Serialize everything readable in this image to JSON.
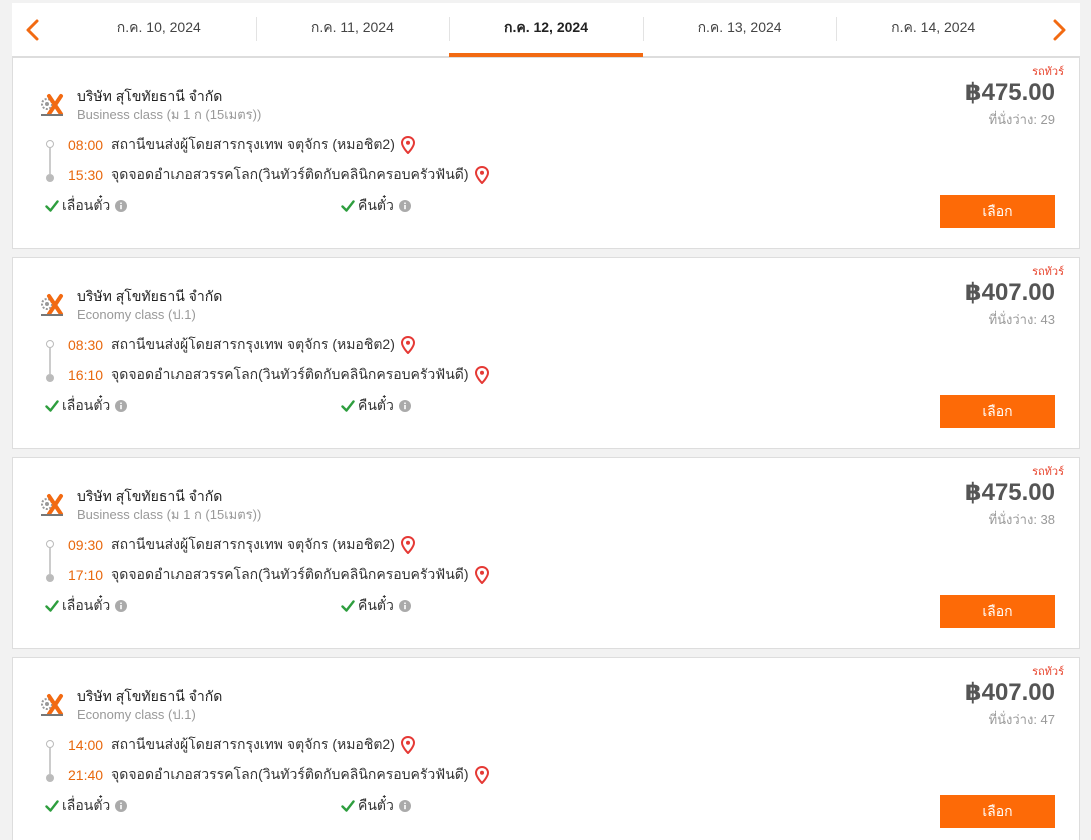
{
  "date_tabs": [
    {
      "label": "ก.ค. 10, 2024"
    },
    {
      "label": "ก.ค. 11, 2024"
    },
    {
      "label": "ก.ค. 12, 2024"
    },
    {
      "label": "ก.ค. 13, 2024"
    },
    {
      "label": "ก.ค. 14, 2024"
    }
  ],
  "active_tab_index": 2,
  "colors": {
    "accent": "#fd6a07",
    "time": "#e8670c",
    "pin": "#e53935",
    "check": "#2e9e3e"
  },
  "trips": [
    {
      "badge": "รถทัวร์",
      "operator": "บริษัท สุโขทัยธานี จำกัด",
      "class": "Business class (ม 1 ก (15เมตร))",
      "price": "฿475.00",
      "seats": "ที่นั่งว่าง: 29",
      "depart_time": "08:00",
      "depart_place": "สถานีขนส่งผู้โดยสารกรุงเทพ จตุจักร (หมอชิต2)",
      "arrive_time": "15:30",
      "arrive_place": "จุดจอดอำเภอสวรรคโลก(วินทัวร์ติดกับคลินิกครอบครัวฟันดี)",
      "feature_reschedule": "เลื่อนตั๋ว",
      "feature_refund": "คืนตั๋ว",
      "select_label": "เลือก"
    },
    {
      "badge": "รถทัวร์",
      "operator": "บริษัท สุโขทัยธานี จำกัด",
      "class": "Economy class (ป.1)",
      "price": "฿407.00",
      "seats": "ที่นั่งว่าง: 43",
      "depart_time": "08:30",
      "depart_place": "สถานีขนส่งผู้โดยสารกรุงเทพ จตุจักร (หมอชิต2)",
      "arrive_time": "16:10",
      "arrive_place": "จุดจอดอำเภอสวรรคโลก(วินทัวร์ติดกับคลินิกครอบครัวฟันดี)",
      "feature_reschedule": "เลื่อนตั๋ว",
      "feature_refund": "คืนตั๋ว",
      "select_label": "เลือก"
    },
    {
      "badge": "รถทัวร์",
      "operator": "บริษัท สุโขทัยธานี จำกัด",
      "class": "Business class (ม 1 ก (15เมตร))",
      "price": "฿475.00",
      "seats": "ที่นั่งว่าง: 38",
      "depart_time": "09:30",
      "depart_place": "สถานีขนส่งผู้โดยสารกรุงเทพ จตุจักร (หมอชิต2)",
      "arrive_time": "17:10",
      "arrive_place": "จุดจอดอำเภอสวรรคโลก(วินทัวร์ติดกับคลินิกครอบครัวฟันดี)",
      "feature_reschedule": "เลื่อนตั๋ว",
      "feature_refund": "คืนตั๋ว",
      "select_label": "เลือก"
    },
    {
      "badge": "รถทัวร์",
      "operator": "บริษัท สุโขทัยธานี จำกัด",
      "class": "Economy class (ป.1)",
      "price": "฿407.00",
      "seats": "ที่นั่งว่าง: 47",
      "depart_time": "14:00",
      "depart_place": "สถานีขนส่งผู้โดยสารกรุงเทพ จตุจักร (หมอชิต2)",
      "arrive_time": "21:40",
      "arrive_place": "จุดจอดอำเภอสวรรคโลก(วินทัวร์ติดกับคลินิกครอบครัวฟันดี)",
      "feature_reschedule": "เลื่อนตั๋ว",
      "feature_refund": "คืนตั๋ว",
      "select_label": "เลือก"
    }
  ]
}
